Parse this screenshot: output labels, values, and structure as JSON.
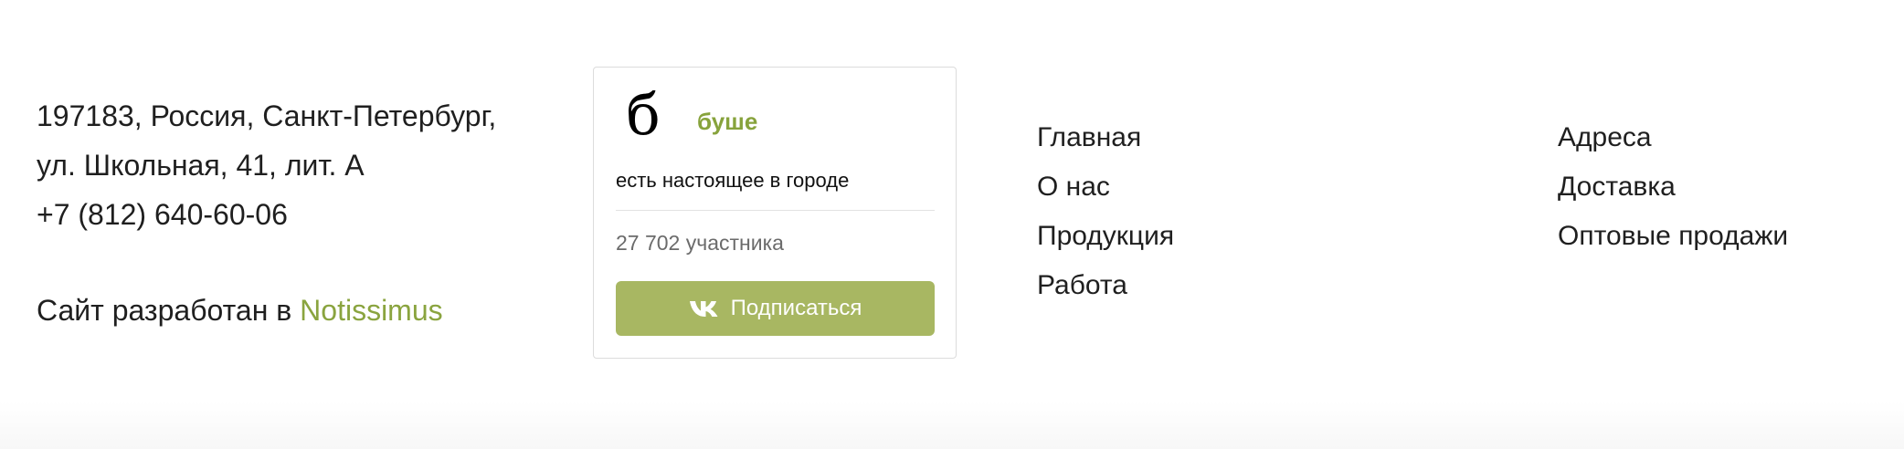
{
  "contacts": {
    "address_line1": "197183, Россия, Санкт-Петербург,",
    "address_line2": "ул. Школьная, 41, лит. А",
    "phone": "+7 (812) 640-60-06"
  },
  "developer": {
    "prefix": "Сайт разработан в ",
    "link_label": "Notissimus",
    "link_color": "#8aa43f"
  },
  "vk_widget": {
    "avatar_letter": "б",
    "group_name": "буше",
    "status": "есть настоящее в городе",
    "members": "27 702 участника",
    "subscribe_label": "Подписаться",
    "subscribe_icon": "vk-logo-icon",
    "button_color": "#a8b762",
    "name_color": "#87a33c"
  },
  "nav": {
    "col1": [
      {
        "label": "Главная"
      },
      {
        "label": "О нас"
      },
      {
        "label": "Продукция"
      },
      {
        "label": "Работа"
      }
    ],
    "col2": [
      {
        "label": "Адреса"
      },
      {
        "label": "Доставка"
      },
      {
        "label": "Оптовые продажи"
      }
    ]
  }
}
